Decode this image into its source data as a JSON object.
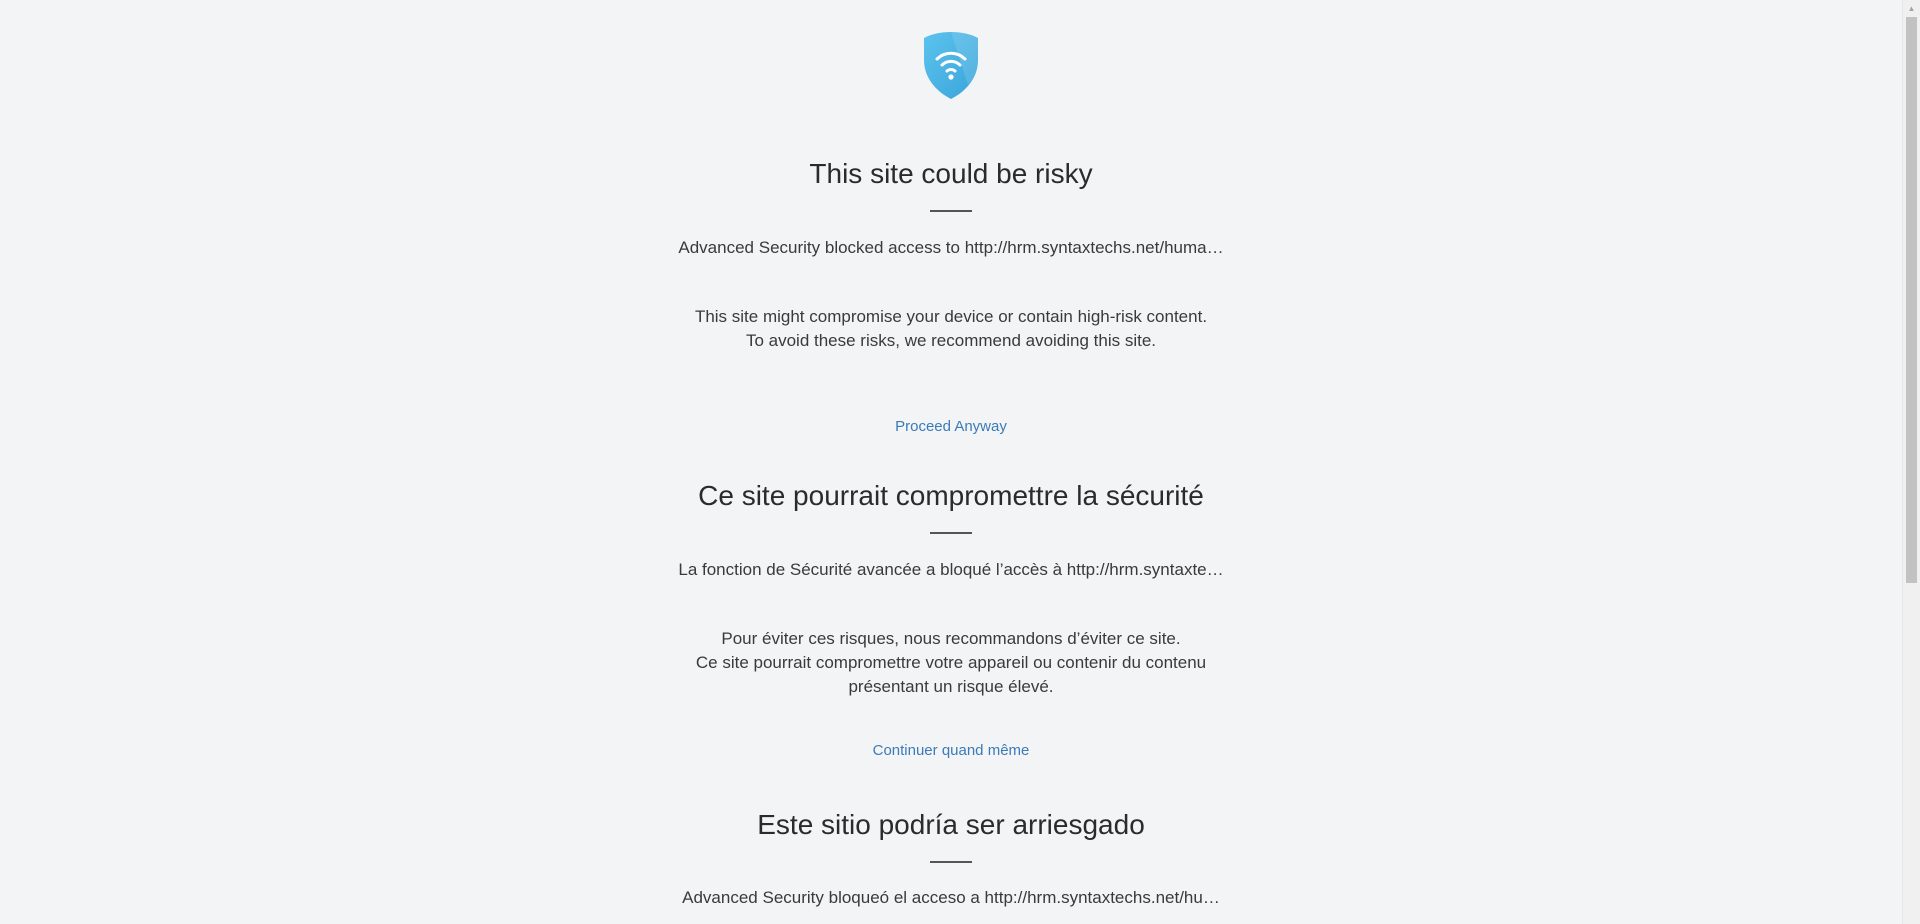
{
  "logo": {
    "icon": "wifi-shield-icon",
    "color": "#4ab4e6"
  },
  "sections": [
    {
      "title": "This site could be risky",
      "blocked": "Advanced Security blocked access to http://hrm.syntaxtechs.net/huma…",
      "desc_lines": [
        "This site might compromise your device or contain high-risk content.",
        "To avoid these risks, we recommend avoiding this site."
      ],
      "link": "Proceed Anyway"
    },
    {
      "title": "Ce site pourrait compromettre la sécurité",
      "blocked": "La fonction de Sécurité avancée a bloqué l’accès à http://hrm.syntaxte…",
      "desc_lines": [
        "Pour éviter ces risques, nous recommandons d’éviter ce site.",
        "Ce site pourrait compromettre votre appareil ou contenir du contenu",
        "présentant un risque élevé."
      ],
      "link": "Continuer quand même"
    },
    {
      "title": "Este sitio podría ser arriesgado",
      "blocked": "Advanced Security bloqueó el acceso a http://hrm.syntaxtechs.net/hu…"
    }
  ],
  "colors": {
    "background": "#f3f4f6",
    "link": "#3b7bb7",
    "text": "#333333"
  }
}
